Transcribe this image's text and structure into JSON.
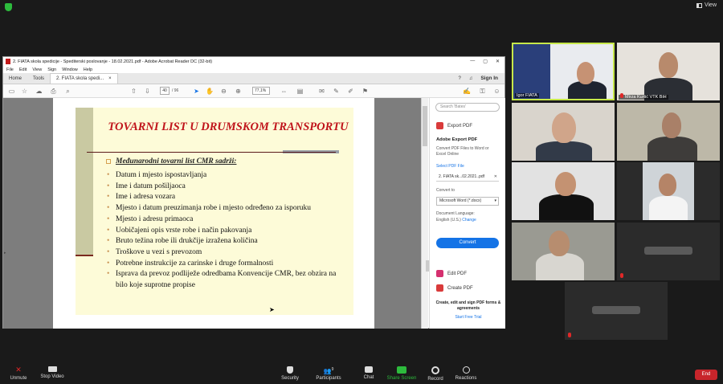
{
  "zoom": {
    "view_label": "View",
    "bottom_bar": {
      "unmute": "Unmute",
      "stop_video": "Stop Video",
      "security": "Security",
      "participants": "Participants",
      "participants_count": "9",
      "chat": "Chat",
      "share_screen": "Share Screen",
      "record": "Record",
      "reactions": "Reactions",
      "end": "End"
    },
    "tiles": [
      {
        "name": "Igor FIATA"
      },
      {
        "name": "Mirza Kurtić VTK BiH"
      },
      {
        "name": ""
      },
      {
        "name": ""
      },
      {
        "name": ""
      },
      {
        "name": ""
      },
      {
        "name": ""
      },
      {
        "name": ""
      },
      {
        "name": ""
      }
    ]
  },
  "acrobat": {
    "window_title": "2. FIATA skola spedicije - Spediterski poslovanje - 18.02.2021.pdf - Adobe Acrobat Reader DC (32-bit)",
    "menu": [
      "File",
      "Edit",
      "View",
      "Sign",
      "Window",
      "Help"
    ],
    "tabs": {
      "home": "Home",
      "tools": "Tools",
      "doc": "2. FIATA skola spedi...",
      "close": "×"
    },
    "sign_in": "Sign In",
    "page_current": "40",
    "page_total": "/ 96",
    "zoom": "77,1%",
    "slide": {
      "title": "TOVARNI LIST U DRUMSKOM TRANSPORTU",
      "subheading": "Međunarodni tovarni list CMR sadrži:",
      "items": [
        "Datum i mjesto ispostavljanja",
        "Ime i datum pošiljaoca",
        "Ime i adresa vozara",
        "Mjesto i datum preuzimanja robe i mjesto određeno za isporuku",
        "Mjesto i adresu primaoca",
        "Uobičajeni opis vrste robe i način pakovanja",
        "Bruto težina robe ili drukčije izražena količina",
        "Troškove u vezi s prevozom",
        "Potrebne instrukcije za carinske i druge formalnosti",
        "Isprava da prevoz podliježe odredbama Konvencije CMR, bez obzira na bilo koje suprotne propise"
      ]
    },
    "right_panel": {
      "search_placeholder": "Search 'Bates'",
      "export_pdf": "Export PDF",
      "adobe_export_pdf": "Adobe Export PDF",
      "description": "Convert PDF Files to Word or Excel Online",
      "select_pdf_file": "Select PDF File",
      "file_name": "2. FIATA sk...02.2021..pdf",
      "convert_to": "Convert to",
      "format": "Microsoft Word (*.docx)",
      "doc_language_label": "Document Language:",
      "doc_language": "English (U.S.)",
      "change": "Change",
      "convert_button": "Convert",
      "edit_pdf": "Edit PDF",
      "create_pdf": "Create PDF",
      "promo": "Create, edit and sign PDF forms & agreements",
      "start_trial": "Start Free Trial"
    }
  }
}
